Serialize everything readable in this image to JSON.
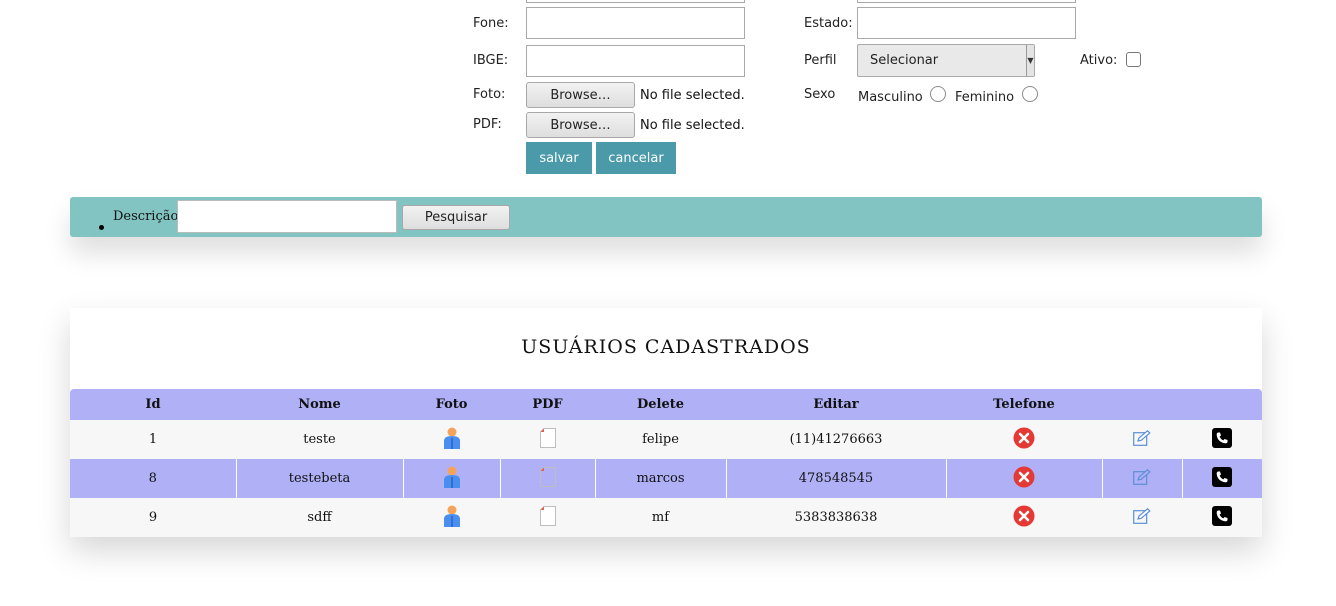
{
  "form": {
    "fone_label": "Fone:",
    "estado_label": "Estado:",
    "ibge_label": "IBGE:",
    "perfil_label": "Perfil",
    "perfil_selected": "Selecionar",
    "ativo_label": "Ativo:",
    "foto_label": "Foto:",
    "pdf_label": "PDF:",
    "browse_label": "Browse…",
    "no_file_text": "No file selected.",
    "sexo_label": "Sexo",
    "masculino_label": "Masculino",
    "feminino_label": "Feminino",
    "salvar_label": "salvar",
    "cancelar_label": "cancelar"
  },
  "search": {
    "label": "Descrição",
    "button_label": "Pesquisar"
  },
  "users_table": {
    "title": "USUÁRIOS CADASTRADOS",
    "headers": [
      "Id",
      "Nome",
      "Foto",
      "PDF",
      "Delete",
      "Editar",
      "Telefone",
      "",
      ""
    ],
    "rows": [
      {
        "id": "1",
        "nome": "teste",
        "col_delete": "felipe",
        "col_editar": "(11)41276663"
      },
      {
        "id": "8",
        "nome": "testebeta",
        "col_delete": "marcos",
        "col_editar": "478548545"
      },
      {
        "id": "9",
        "nome": "sdff",
        "col_delete": "mf",
        "col_editar": "5383838638"
      }
    ],
    "icons": {
      "foto": "user-icon",
      "pdf": "document-icon",
      "delete": "delete-icon",
      "edit": "edit-icon",
      "phone": "phone-icon"
    }
  },
  "colors": {
    "action_button": "#4a9aa9",
    "search_bar": "#82c4c1",
    "table_header": "#b0b0f7",
    "delete_icon": "#e53935"
  }
}
